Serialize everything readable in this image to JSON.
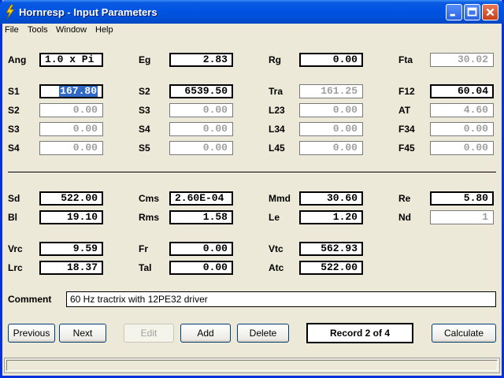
{
  "window": {
    "title": "Hornresp - Input Parameters"
  },
  "menu": [
    "File",
    "Tools",
    "Window",
    "Help"
  ],
  "row_top": [
    {
      "label": "Ang",
      "value": "1.0 x Pi"
    },
    {
      "label": "Eg",
      "value": "2.83"
    },
    {
      "label": "Rg",
      "value": "0.00"
    },
    {
      "label": "Fta",
      "value": "30.02"
    }
  ],
  "horn": [
    {
      "label": "S1",
      "value": "167.80"
    },
    {
      "label": "S2",
      "value": "0.00"
    },
    {
      "label": "S3",
      "value": "0.00"
    },
    {
      "label": "S4",
      "value": "0.00"
    },
    {
      "label": "S2",
      "value": "6539.50"
    },
    {
      "label": "S3",
      "value": "0.00"
    },
    {
      "label": "S4",
      "value": "0.00"
    },
    {
      "label": "S5",
      "value": "0.00"
    },
    {
      "label": "Tra",
      "value": "161.25"
    },
    {
      "label": "L23",
      "value": "0.00"
    },
    {
      "label": "L34",
      "value": "0.00"
    },
    {
      "label": "L45",
      "value": "0.00"
    },
    {
      "label": "F12",
      "value": "60.04"
    },
    {
      "label": "AT",
      "value": "4.60"
    },
    {
      "label": "F34",
      "value": "0.00"
    },
    {
      "label": "F45",
      "value": "0.00"
    }
  ],
  "driver": [
    {
      "label": "Sd",
      "value": "522.00"
    },
    {
      "label": "Bl",
      "value": "19.10"
    },
    {
      "label": "Cms",
      "value": "2.60E-04"
    },
    {
      "label": "Rms",
      "value": "1.58"
    },
    {
      "label": "Mmd",
      "value": "30.60"
    },
    {
      "label": "Le",
      "value": "1.20"
    },
    {
      "label": "Re",
      "value": "5.80"
    },
    {
      "label": "Nd",
      "value": "1"
    }
  ],
  "chamber": [
    {
      "label": "Vrc",
      "value": "9.59"
    },
    {
      "label": "Lrc",
      "value": "18.37"
    },
    {
      "label": "Fr",
      "value": "0.00"
    },
    {
      "label": "Tal",
      "value": "0.00"
    },
    {
      "label": "Vtc",
      "value": "562.93"
    },
    {
      "label": "Atc",
      "value": "522.00"
    }
  ],
  "comment": {
    "label": "Comment",
    "value": "60 Hz tractrix with 12PE32 driver"
  },
  "buttons": {
    "previous": "Previous",
    "next": "Next",
    "edit": "Edit",
    "add": "Add",
    "delete": "Delete",
    "record": "Record 2 of 4",
    "calculate": "Calculate"
  },
  "colors": {
    "title_bar": "#0054e3",
    "window_bg": "#ece9d8",
    "selection": "#316ac5",
    "disabled_text": "#a0a0a0"
  },
  "icons": [
    "hornresp-app-icon",
    "minimize-icon",
    "maximize-icon",
    "close-icon"
  ]
}
